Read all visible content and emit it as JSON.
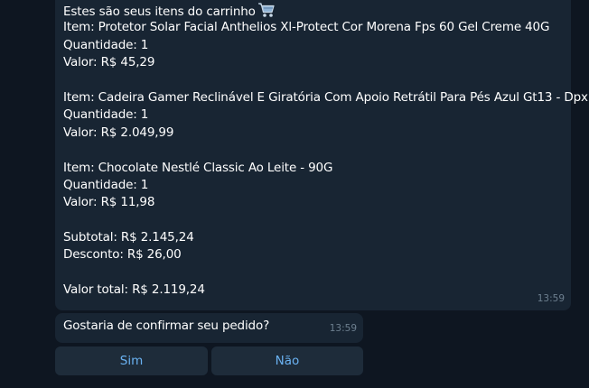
{
  "cart_message": {
    "header": "Estes são seus itens do carrinho",
    "header_icon": "shopping-cart-icon",
    "items": [
      {
        "name": "Item: Protetor Solar Facial Anthelios Xl-Protect Cor Morena Fps 60 Gel Creme 40G",
        "quantity": "Quantidade: 1",
        "value": "Valor: R$ 45,29"
      },
      {
        "name": "Item: Cadeira Gamer Reclinável E Giratória Com Apoio Retrátil Para Pés Azul Gt13 - Dpx",
        "quantity": "Quantidade: 1",
        "value": "Valor: R$ 2.049,99"
      },
      {
        "name": "Item: Chocolate Nestlé Classic Ao Leite - 90G",
        "quantity": "Quantidade: 1",
        "value": "Valor: R$ 11,98"
      }
    ],
    "subtotal": "Subtotal: R$ 2.145,24",
    "discount": "Desconto: R$ 26,00",
    "total": "Valor total: R$ 2.119,24",
    "time": "13:59"
  },
  "confirm_message": {
    "text": "Gostaria de confirmar seu pedido?",
    "time": "13:59"
  },
  "buttons": {
    "yes_label": "Sim",
    "no_label": "Não"
  },
  "colors": {
    "background": "#0e1621",
    "bubble": "#182533",
    "button": "#1e2c3a",
    "button_text": "#6ab2f2",
    "timestamp": "#6d7f8f"
  }
}
